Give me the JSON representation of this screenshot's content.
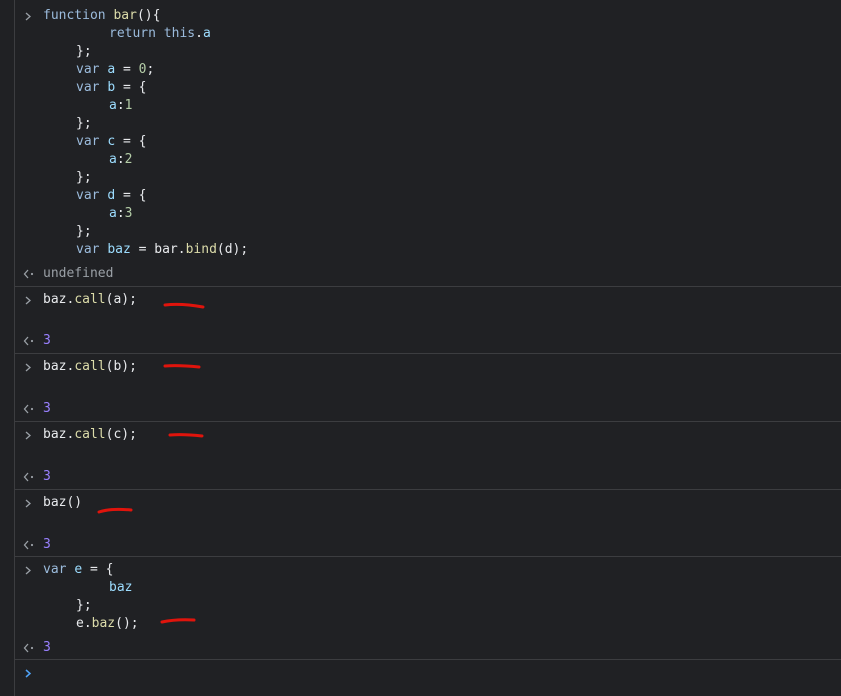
{
  "console": {
    "entries": [
      {
        "input_lines": [
          [
            "function",
            " ",
            "bar",
            "(){"
          ],
          [
            "return",
            " ",
            "this",
            ".",
            "a"
          ],
          [
            "};"
          ],
          [
            "var",
            " ",
            "a",
            " = ",
            "0",
            ";"
          ],
          [
            "var",
            " ",
            "b",
            " = {"
          ],
          [
            "a",
            ":",
            "1"
          ],
          [
            "};"
          ],
          [
            "var",
            " ",
            "c",
            " = {"
          ],
          [
            "a",
            ":",
            "2"
          ],
          [
            "};"
          ],
          [
            "var",
            " ",
            "d",
            " = {"
          ],
          [
            "a",
            ":",
            "3"
          ],
          [
            "};"
          ],
          [
            "var",
            " ",
            "baz",
            " = bar.",
            "bind",
            "(d);"
          ]
        ],
        "result": "undefined"
      },
      {
        "input": [
          "baz.",
          "call",
          "(a);"
        ],
        "result": "3"
      },
      {
        "input": [
          "baz.",
          "call",
          "(b);"
        ],
        "result": "3"
      },
      {
        "input": [
          "baz.",
          "call",
          "(c);"
        ],
        "result": "3"
      },
      {
        "input": [
          "baz()"
        ],
        "result": "3"
      },
      {
        "input_lines": [
          [
            "var",
            " ",
            "e",
            " = {"
          ],
          [
            "baz"
          ],
          [
            "};"
          ],
          [
            "e.",
            "baz",
            "();"
          ]
        ],
        "result": "3"
      }
    ],
    "prompt_symbol": ">",
    "result_symbol": "<"
  },
  "annotations": {
    "underline_color": "#e0140c"
  }
}
